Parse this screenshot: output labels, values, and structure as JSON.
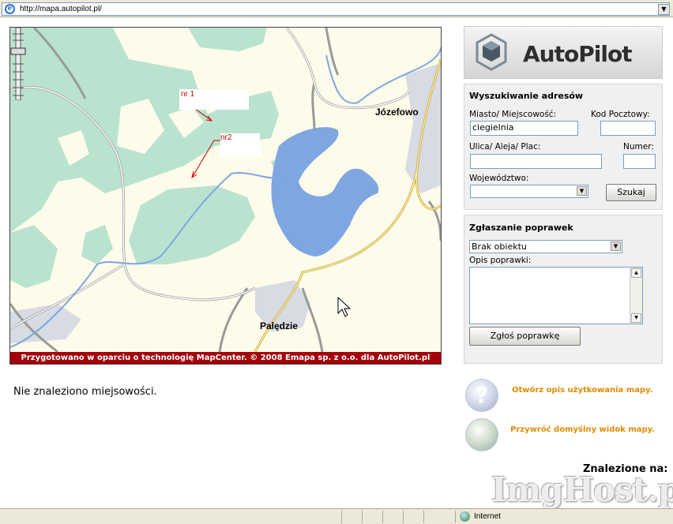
{
  "browser": {
    "url": "http://mapa.autopilot.pl/",
    "status_zone": "Internet"
  },
  "map": {
    "places": [
      "Józefowo",
      "Palędzie"
    ],
    "markers": [
      "nr 1",
      "nr2"
    ],
    "footer": "Przygotowano w oparciu o technologię MapCenter. © 2008 Emapa sp. z o.o. dla AutoPilot.pl"
  },
  "logo": {
    "text": "AutoPilot"
  },
  "search": {
    "title": "Wyszukiwanie adresów",
    "city_label": "Miasto/ Miejscowość:",
    "city_value": "ciegielnia",
    "zip_label": "Kod Pocztowy:",
    "zip_value": "",
    "street_label": "Ulica/ Aleja/ Plac:",
    "street_value": "",
    "number_label": "Numer:",
    "number_value": "",
    "voivodeship_label": "Województwo:",
    "voivodeship_value": "",
    "submit_label": "Szukaj"
  },
  "corrections": {
    "title": "Zgłaszanie poprawek",
    "type_value": "Brak obiektu",
    "desc_label": "Opis poprawki:",
    "desc_value": "",
    "submit_label": "Zgłoś poprawkę"
  },
  "results": {
    "message": "Nie znaleziono miejsowości.",
    "found_on": "Znalezione na:"
  },
  "links": {
    "help": "Otwórz opis użytkowania mapy.",
    "reset_view": "Przywróć domyślny widok mapy."
  },
  "watermark": "ImgHost.pl",
  "colors": {
    "footer_red": "#a3000a",
    "forest": "#b9e3cf",
    "water": "#7ea6e0",
    "link_orange": "#e08a00"
  }
}
